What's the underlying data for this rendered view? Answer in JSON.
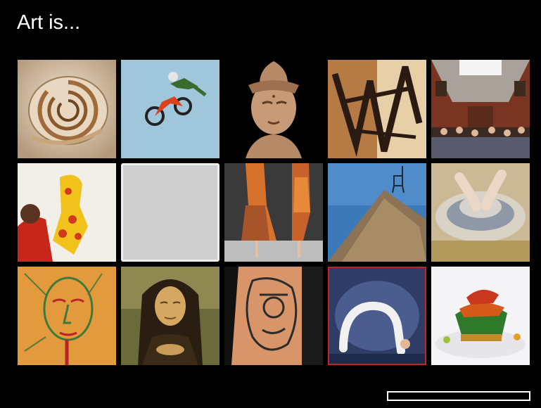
{
  "page": {
    "title": "Art is..."
  },
  "gallery": {
    "tiles": [
      {
        "name": "nautilus-shell-image"
      },
      {
        "name": "motocross-jump-image"
      },
      {
        "name": "buddha-statue-image"
      },
      {
        "name": "graffiti-wall-image"
      },
      {
        "name": "museum-gallery-image"
      },
      {
        "name": "child-painting-giraffe-image"
      },
      {
        "name": "empty-placeholder-tile"
      },
      {
        "name": "fashion-runway-image"
      },
      {
        "name": "rock-pile-chair-image"
      },
      {
        "name": "pottery-wheel-image"
      },
      {
        "name": "picasso-face-drawing-image"
      },
      {
        "name": "mona-lisa-image"
      },
      {
        "name": "tattooed-arm-image"
      },
      {
        "name": "contortionist-backbend-image"
      },
      {
        "name": "gourmet-food-plate-image"
      }
    ],
    "selected_index": 13,
    "placeholder_index": 6
  },
  "progress": {
    "value": 0,
    "border_color": "#ffffff"
  },
  "colors": {
    "background": "#000000",
    "selected_border": "#c0251f"
  }
}
